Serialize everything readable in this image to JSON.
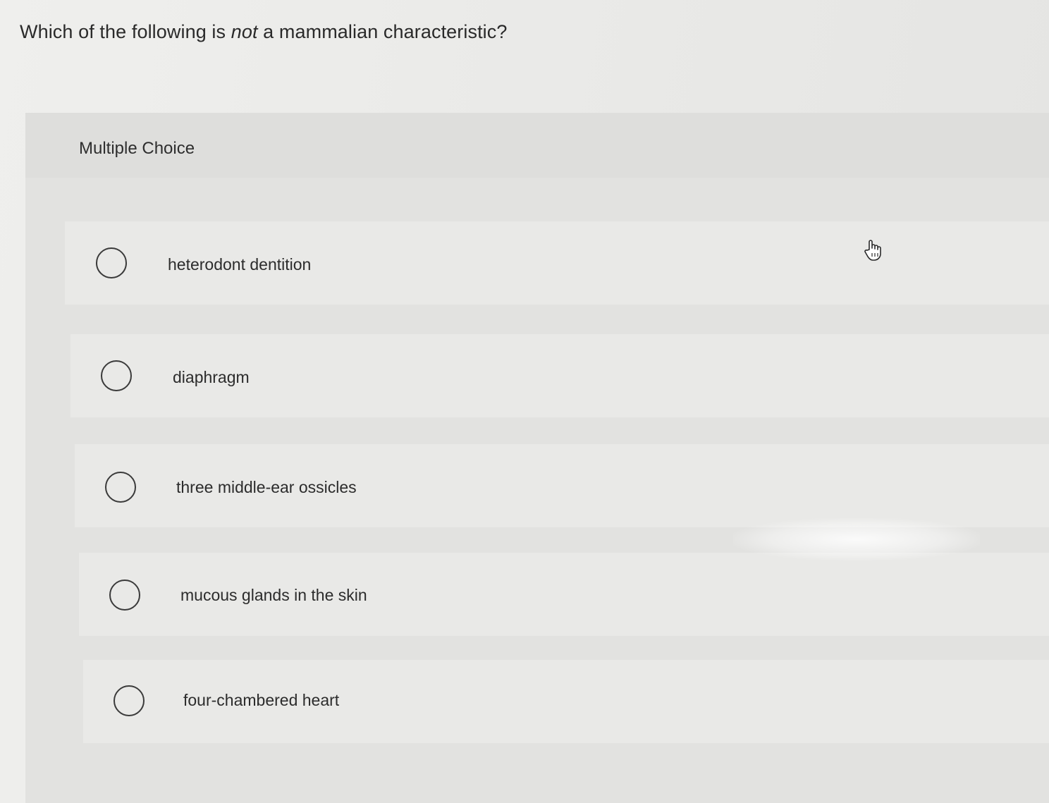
{
  "question": {
    "before": "Which of the following is ",
    "emphasis": "not",
    "after": " a mammalian characteristic?"
  },
  "mc_label": "Multiple Choice",
  "options": [
    {
      "text": "heterodont dentition",
      "selected": false
    },
    {
      "text": "diaphragm",
      "selected": false
    },
    {
      "text": "three middle-ear ossicles",
      "selected": false
    },
    {
      "text": "mucous glands in the skin",
      "selected": false
    },
    {
      "text": "four-chambered heart",
      "selected": false
    }
  ],
  "cursor_icon": "hand-pointer-icon"
}
